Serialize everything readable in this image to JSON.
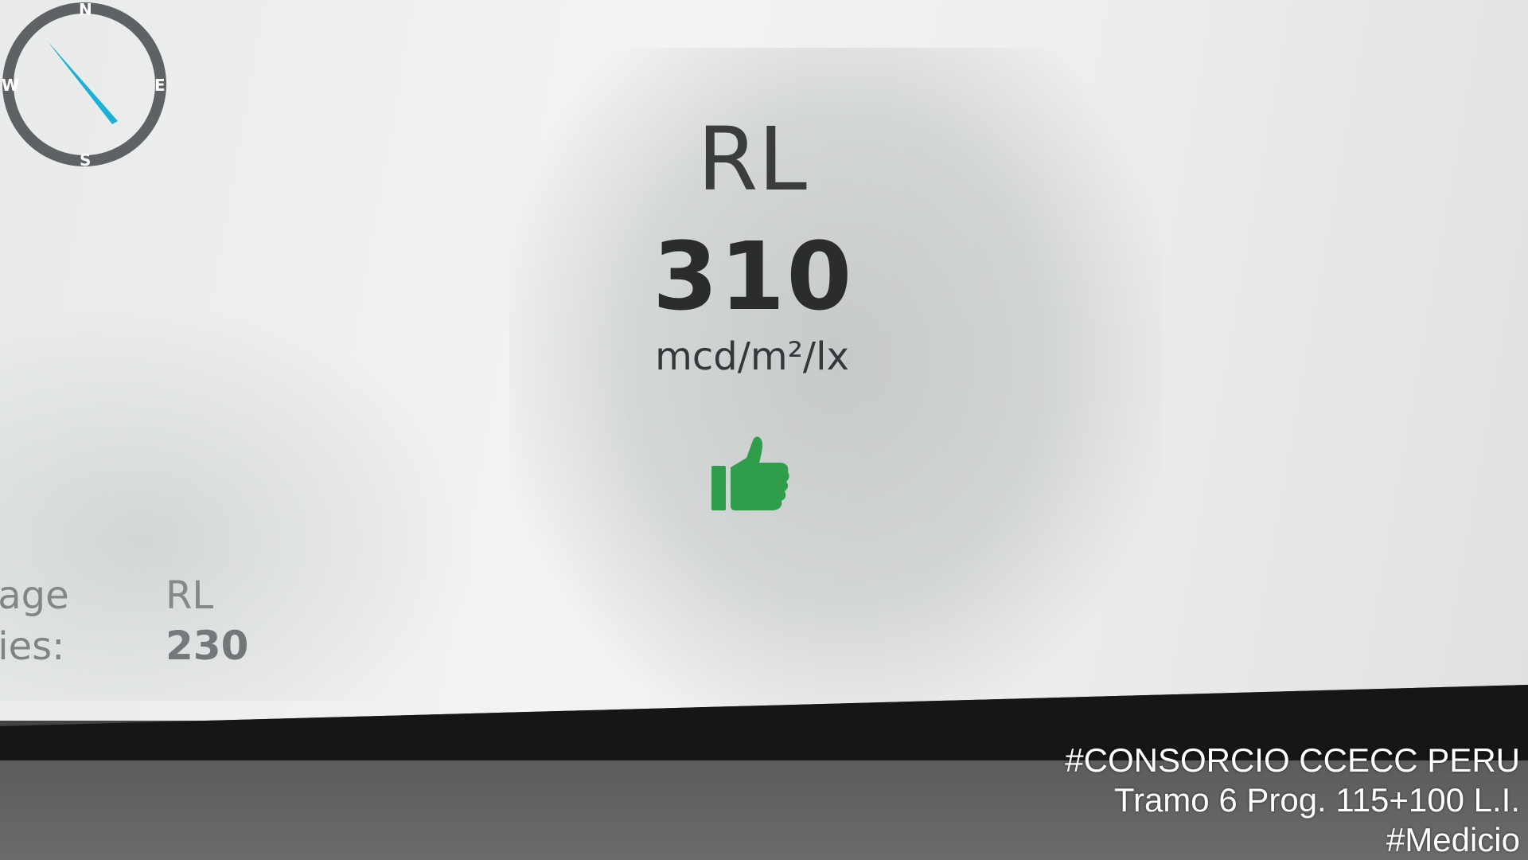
{
  "readout": {
    "label": "RL",
    "value": "310",
    "unit": "mcd/m²/lx",
    "status_icon": "thumbs-up-icon",
    "status_color": "#2e9e4a"
  },
  "average": {
    "row1_key": "erage",
    "row1_val": "RL",
    "row2_key": "eries:",
    "row2_val": "230"
  },
  "compass": {
    "north": "N",
    "east": "E",
    "south": "S",
    "west": "W",
    "needle_color": "#1ab0d8"
  },
  "watermark": {
    "line1": "#CONSORCIO CCECC PERU",
    "line2": "Tramo 6 Prog. 115+100 L.I.",
    "line3": "#Medicio"
  }
}
